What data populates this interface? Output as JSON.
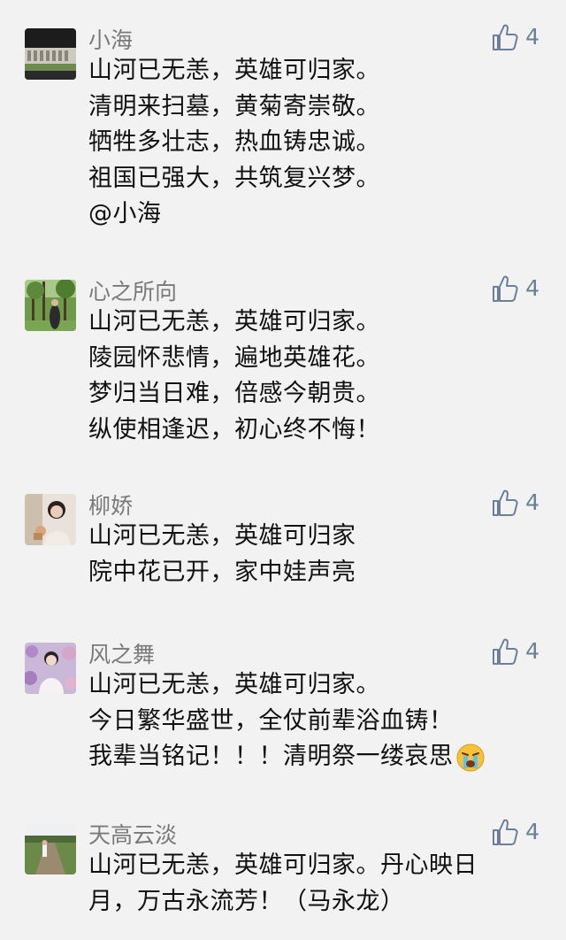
{
  "colors": {
    "background": "#f2f2f2",
    "name_gray": "#7a7a7a",
    "like_blue": "#6b7f99",
    "text": "#111111"
  },
  "comments": [
    {
      "user": "小海",
      "likes": "4",
      "like_icon": "thumbs-up-icon",
      "lines": [
        "山河已无恙，英雄可归家。",
        "清明来扫墓，黄菊寄崇敬。",
        "牺牲多壮志，热血铸忠诚。",
        "祖国已强大，共筑复兴梦。",
        "@小海"
      ]
    },
    {
      "user": "心之所向",
      "likes": "4",
      "like_icon": "thumbs-up-icon",
      "lines": [
        "山河已无恙，英雄可归家。",
        "陵园怀悲情，遍地英雄花。",
        "梦归当日难，倍感今朝贵。",
        "纵使相逢迟，初心终不悔！"
      ]
    },
    {
      "user": "柳娇",
      "likes": "4",
      "like_icon": "thumbs-up-icon",
      "lines": [
        "山河已无恙，英雄可归家",
        "院中花已开，家中娃声亮"
      ]
    },
    {
      "user": "风之舞",
      "likes": "4",
      "like_icon": "thumbs-up-icon",
      "lines": [
        "山河已无恙，英雄可归家。",
        "今日繁华盛世，全仗前辈浴血铸！",
        "我辈当铭记！！！清明祭一缕哀思"
      ],
      "emoji": "crying-face-icon"
    },
    {
      "user": "天高云淡",
      "likes": "4",
      "like_icon": "thumbs-up-icon",
      "lines": [
        "山河已无恙，英雄可归家。丹心映日",
        "月，万古永流芳！（马永龙）"
      ]
    }
  ]
}
